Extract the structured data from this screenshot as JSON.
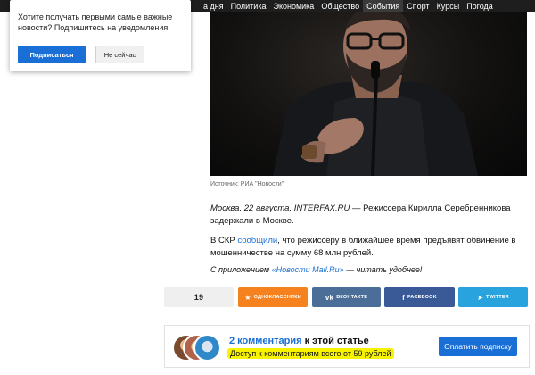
{
  "nav": {
    "items": [
      "а дня",
      "Политика",
      "Экономика",
      "Общество",
      "События",
      "Спорт",
      "Курсы",
      "Погода"
    ],
    "active": "События"
  },
  "notification": {
    "message": "Хотите получать первыми самые важные новости? Подпишитесь на уведомления!",
    "subscribe": "Подписаться",
    "later": "Не сейчас"
  },
  "photo": {
    "caption": "Источник: РИА \"Новости\""
  },
  "article": {
    "p1_place_date": "Москва. 22 августа.",
    "p1_agency": "INTERFAX.RU",
    "p1_rest": " — Режиссера Кирилла Серебренникова задержали в Москве.",
    "p2_start": "В СКР ",
    "p2_link": "сообщили",
    "p2_end": ", что режиссеру в ближайшее время предъявят обвинение в мошенничестве на сумму 68 млн рублей.",
    "p3_start": "С приложением ",
    "p3_link": "«Новости Mail.Ru»",
    "p3_end": " — читать удобнее!"
  },
  "share": {
    "count": "19",
    "ok": "ОДНОКЛАССНИКИ",
    "vk": "ВКОНТАКТЕ",
    "fb": "FACEBOOK",
    "tw": "TWITTER"
  },
  "comments": {
    "count_link": "2 комментария",
    "title_rest": " к этой статье",
    "note": "Доступ к комментариям всего от 59 рублей",
    "pay_button": "Оплатить подписку"
  },
  "colors": {
    "accent": "#1a6fd6",
    "ok": "#f5821f",
    "vk": "#4a6e97",
    "fb": "#3a5a97",
    "tw": "#29a3de",
    "highlight": "#f7f300"
  }
}
